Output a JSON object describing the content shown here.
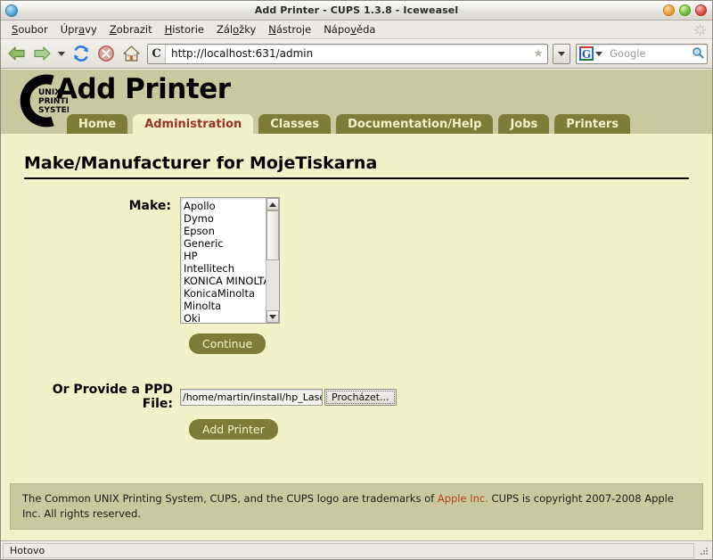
{
  "window": {
    "title": "Add Printer - CUPS 1.3.8 - Iceweasel",
    "icon": "globe-icon",
    "buttons": {
      "minimize": "minimize",
      "maximize": "maximize",
      "close": "close"
    }
  },
  "menubar": {
    "items": [
      {
        "label": "Soubor",
        "accel": "S"
      },
      {
        "label": "Úpravy",
        "accel": "a"
      },
      {
        "label": "Zobrazit",
        "accel": "Z"
      },
      {
        "label": "Historie",
        "accel": "H"
      },
      {
        "label": "Záložky",
        "accel": "o"
      },
      {
        "label": "Nástroje",
        "accel": "N"
      },
      {
        "label": "Nápověda",
        "accel": "v"
      }
    ]
  },
  "toolbar": {
    "back_icon": "back-arrow-icon",
    "forward_icon": "forward-arrow-icon",
    "history_caret": "chevron-down-icon",
    "reload_icon": "reload-icon",
    "stop_icon": "stop-icon",
    "home_icon": "home-icon",
    "url": "http://localhost:631/admin",
    "url_favicon": "C",
    "bookmark_star": "★",
    "url_dropdown": "chevron-down-icon",
    "search_engine": "G",
    "search_placeholder": "Google",
    "search_icon": "magnifier-icon"
  },
  "page": {
    "logo_lines": [
      "UNIX",
      "PRINTING",
      "SYSTEM"
    ],
    "logo_letter": "C",
    "title": "Add Printer",
    "tabs": [
      {
        "label": "Home",
        "active": false
      },
      {
        "label": "Administration",
        "active": true
      },
      {
        "label": "Classes",
        "active": false
      },
      {
        "label": "Documentation/Help",
        "active": false
      },
      {
        "label": "Jobs",
        "active": false
      },
      {
        "label": "Printers",
        "active": false
      }
    ],
    "heading": "Make/Manufacturer for MojeTiskarna",
    "make_label": "Make:",
    "make_options": [
      "Apollo",
      "Dymo",
      "Epson",
      "Generic",
      "HP",
      "Intellitech",
      "KONICA MINOLTA",
      "KonicaMinolta",
      "Minolta",
      "Oki"
    ],
    "continue_button": "Continue",
    "ppd_label": "Or Provide a PPD File:",
    "ppd_value": "/home/martin/install/hp_Lase",
    "browse_button": "Procházet...",
    "add_printer_button": "Add Printer",
    "footer_part1": "The Common UNIX Printing System, CUPS, and the CUPS logo are trademarks of ",
    "footer_link": "Apple Inc.",
    "footer_part2": " CUPS is copyright 2007-2008 Apple Inc. All rights reserved."
  },
  "statusbar": {
    "text": "Hotovo"
  },
  "colors": {
    "page_bg": "#f2f2c9",
    "header_bg": "#c9c9a0",
    "tab_inactive": "#7d7d39",
    "tab_active_text": "#9a3324",
    "link_red": "#b5411f"
  }
}
